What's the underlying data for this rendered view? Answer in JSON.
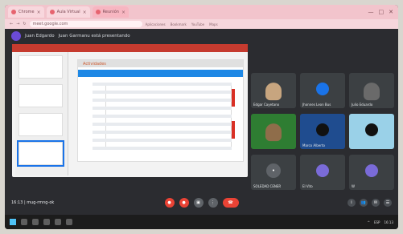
{
  "browser": {
    "tabs": [
      {
        "label": "Chrome",
        "active": false
      },
      {
        "label": "Aula Virtual",
        "active": false
      },
      {
        "label": "Reunión",
        "active": true
      }
    ],
    "url": "meet.google.com",
    "bookmarks": [
      "Aplicaciones",
      "Bookmark",
      "YouTube",
      "Maps"
    ]
  },
  "meet": {
    "banner_name": "Juan Edgardo",
    "banner_text": "Juan Garmanu está presentando",
    "doc_title": "Actividades",
    "participants": [
      {
        "name": "Edgar Cayetano",
        "type": "video"
      },
      {
        "name": "Jhonnes Leon Bus",
        "type": "avatar"
      },
      {
        "name": "Julio Eduardo",
        "type": "video"
      },
      {
        "name": "",
        "type": "video"
      },
      {
        "name": "Marco Alberto",
        "type": "avatar"
      },
      {
        "name": "",
        "type": "avatar"
      },
      {
        "name": "SOLEDAD CENER",
        "type": "avatar"
      },
      {
        "name": "El Vito",
        "type": "avatar"
      },
      {
        "name": "W",
        "type": "avatar"
      }
    ],
    "meeting_code": "16:13 | mug-rmng-ok",
    "controls": [
      "mic",
      "camera",
      "present",
      "more",
      "leave"
    ],
    "right_controls": [
      "info",
      "people",
      "chat",
      "activities"
    ]
  },
  "taskbar": {
    "tray_text": [
      "^",
      "ESP",
      "16:13"
    ]
  },
  "colors": {
    "tab_bg": "#f2c4cc",
    "meet_bg": "#2b2c30",
    "accent_blue": "#1a73e8",
    "accent_red": "#ea4335"
  }
}
